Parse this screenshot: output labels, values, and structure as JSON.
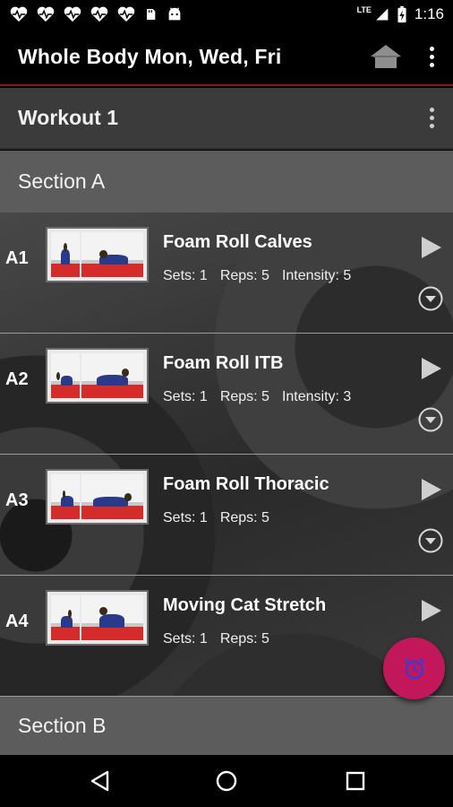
{
  "status_bar": {
    "time": "1:16",
    "network": "LTE",
    "notification_icons": [
      "heartbeat-icon",
      "heartbeat-icon",
      "heartbeat-icon",
      "heartbeat-icon",
      "heartbeat-icon",
      "sd-card-icon",
      "android-icon"
    ]
  },
  "app_bar": {
    "title": "Whole Body Mon, Wed, Fri",
    "icons": [
      "home-icon",
      "overflow-menu-icon"
    ]
  },
  "workout": {
    "title": "Workout 1"
  },
  "sections": [
    {
      "title": "Section A",
      "exercises": [
        {
          "code": "A1",
          "name": "Foam Roll Calves",
          "sets": "Sets: 1",
          "reps": "Reps: 5",
          "intensity": "Intensity: 5",
          "has_expand": true
        },
        {
          "code": "A2",
          "name": "Foam Roll ITB",
          "sets": "Sets: 1",
          "reps": "Reps: 5",
          "intensity": "Intensity: 3",
          "has_expand": true
        },
        {
          "code": "A3",
          "name": "Foam Roll Thoracic",
          "sets": "Sets: 1",
          "reps": "Reps: 5",
          "intensity": "",
          "has_expand": true
        },
        {
          "code": "A4",
          "name": "Moving Cat Stretch",
          "sets": "Sets: 1",
          "reps": "Reps: 5",
          "intensity": "",
          "has_expand": false
        }
      ]
    },
    {
      "title": "Section B"
    }
  ],
  "fab": {
    "icon": "alarm-clock-icon"
  },
  "colors": {
    "accent": "#c2185b",
    "app_bar_underline": "#8a1a1a",
    "workout_bar": "#3b3b3b",
    "section_bar": "#5c5c5c"
  }
}
